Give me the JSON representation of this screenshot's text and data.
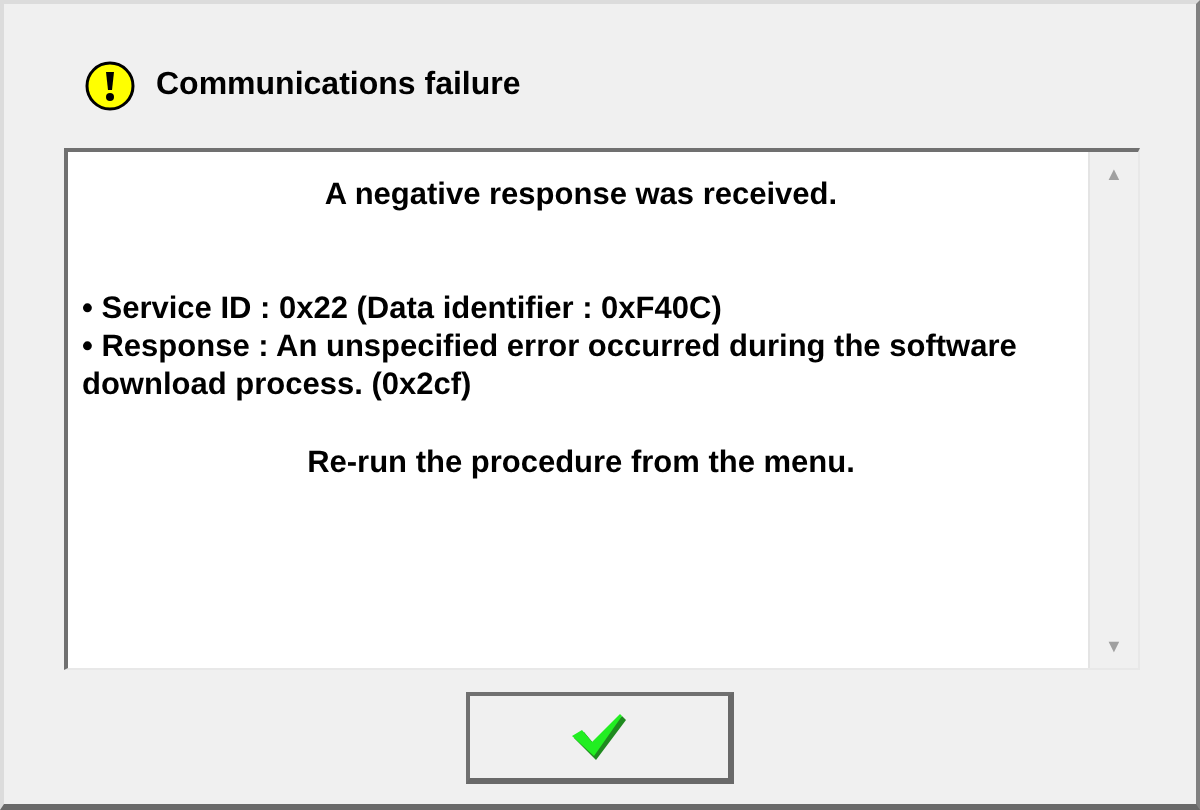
{
  "dialog": {
    "title": "Communications failure",
    "heading": "A negative response was received.",
    "bullets": [
      "• Service ID : 0x22 (Data identifier : 0xF40C)",
      "• Response : An unspecified error occurred during the software download process. (0x2cf)"
    ],
    "footer_text": "Re-run the procedure from the menu.",
    "scroll_up": "▲",
    "scroll_down": "▼"
  }
}
